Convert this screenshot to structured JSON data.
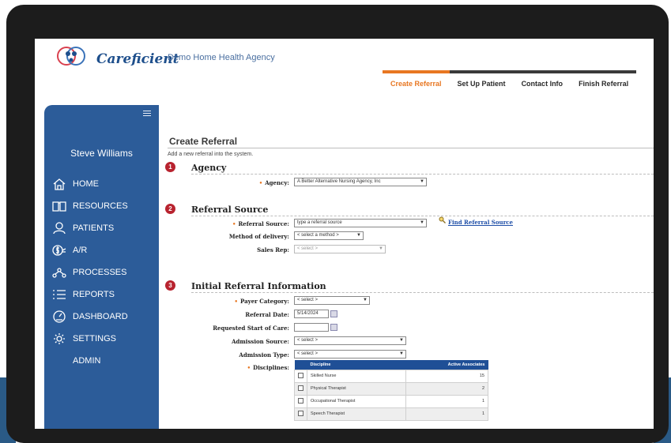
{
  "header": {
    "brand": "Careficient",
    "agency": "Demo Home Health Agency"
  },
  "steps": [
    {
      "label": "Create Referral",
      "active": true
    },
    {
      "label": "Set Up Patient",
      "active": false
    },
    {
      "label": "Contact Info",
      "active": false
    },
    {
      "label": "Finish Referral",
      "active": false
    }
  ],
  "sidebar": {
    "user": "Steve Williams",
    "items": [
      {
        "label": "HOME",
        "icon": "home-icon"
      },
      {
        "label": "RESOURCES",
        "icon": "book-icon"
      },
      {
        "label": "PATIENTS",
        "icon": "person-icon"
      },
      {
        "label": "A/R",
        "icon": "dollar-hand-icon"
      },
      {
        "label": "PROCESSES",
        "icon": "process-icon"
      },
      {
        "label": "REPORTS",
        "icon": "list-icon"
      },
      {
        "label": "DASHBOARD",
        "icon": "gauge-icon"
      },
      {
        "label": "SETTINGS",
        "icon": "gear-icon"
      },
      {
        "label": "ADMIN",
        "icon": ""
      }
    ]
  },
  "page": {
    "title": "Create Referral",
    "subtitle": "Add a new referral into the system."
  },
  "agency_section": {
    "num": "1",
    "title": "Agency",
    "agency_label": "Agency:",
    "agency_value": "A Better Alternative Nursing Agency, Inc"
  },
  "source_section": {
    "num": "2",
    "title": "Referral Source",
    "source_label": "Referral Source:",
    "source_placeholder": "type a referral source",
    "find_link": "Find Referral Source",
    "method_label": "Method of delivery:",
    "method_value": "< select a method >",
    "sales_label": "Sales Rep:",
    "sales_value": "< select >"
  },
  "initial_section": {
    "num": "3",
    "title": "Initial Referral Information",
    "payer_label": "Payer Category:",
    "payer_value": "< select >",
    "date_label": "Referral Date:",
    "date_value": "5/14/2024",
    "start_label": "Requested Start of Care:",
    "start_value": "",
    "adm_source_label": "Admission Source:",
    "adm_source_value": "< select >",
    "adm_type_label": "Admission Type:",
    "adm_type_value": "< select >",
    "disc_label": "Disciplines:",
    "table_headers": [
      "Discipline",
      "Active Associates"
    ],
    "rows": [
      {
        "discipline": "Skilled Nurse",
        "count": "15"
      },
      {
        "discipline": "Physical Therapist",
        "count": "2"
      },
      {
        "discipline": "Occupational Therapist",
        "count": "1"
      },
      {
        "discipline": "Speech Therapist",
        "count": "1"
      }
    ]
  },
  "colors": {
    "sidebar": "#2c5c99",
    "accent": "#e87722",
    "section_badge": "#b8232f",
    "table_header": "#1f4f96"
  }
}
